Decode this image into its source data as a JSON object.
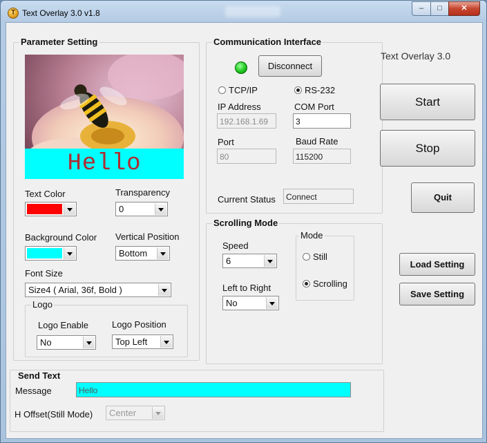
{
  "window": {
    "title": "Text Overlay 3.0 v1.8"
  },
  "parameter_setting": {
    "legend": "Parameter Setting",
    "preview_text": "Hello",
    "text_color_label": "Text Color",
    "text_color": "#ff0000",
    "transparency_label": "Transparency",
    "transparency_value": "0",
    "background_color_label": "Background Color",
    "background_color": "#00ffff",
    "vertical_position_label": "Vertical Position",
    "vertical_position_value": "Bottom",
    "font_size_label": "Font Size",
    "font_size_value": "Size4 ( Arial, 36f, Bold )",
    "logo": {
      "legend": "Logo",
      "enable_label": "Logo Enable",
      "enable_value": "No",
      "position_label": "Logo Position",
      "position_value": "Top Left"
    }
  },
  "communication": {
    "legend": "Communication Interface",
    "led_color": "#1ec81e",
    "disconnect_label": "Disconnect",
    "tcpip_label": "TCP/IP",
    "rs232_label": "RS-232",
    "selected": "RS-232",
    "ip_address_label": "IP Address",
    "ip_address_value": "192.168.1.69",
    "com_port_label": "COM Port",
    "com_port_value": "3",
    "port_label": "Port",
    "port_value": "80",
    "baud_rate_label": "Baud Rate",
    "baud_rate_value": "115200",
    "current_status_label": "Current Status",
    "current_status_value": "Connect"
  },
  "scrolling": {
    "legend": "Scrolling Mode",
    "speed_label": "Speed",
    "speed_value": "6",
    "left_to_right_label": "Left to Right",
    "left_to_right_value": "No",
    "mode": {
      "legend": "Mode",
      "still_label": "Still",
      "scrolling_label": "Scrolling",
      "selected": "Scrolling"
    }
  },
  "right_panel": {
    "app_label": "Text Overlay 3.0",
    "start_label": "Start",
    "stop_label": "Stop",
    "quit_label": "Quit",
    "load_label": "Load Setting",
    "save_label": "Save Setting"
  },
  "send_text": {
    "legend": "Send Text",
    "message_label": "Message",
    "message_value": "Hello",
    "h_offset_label": "H Offset(Still Mode)",
    "h_offset_value": "Center"
  }
}
